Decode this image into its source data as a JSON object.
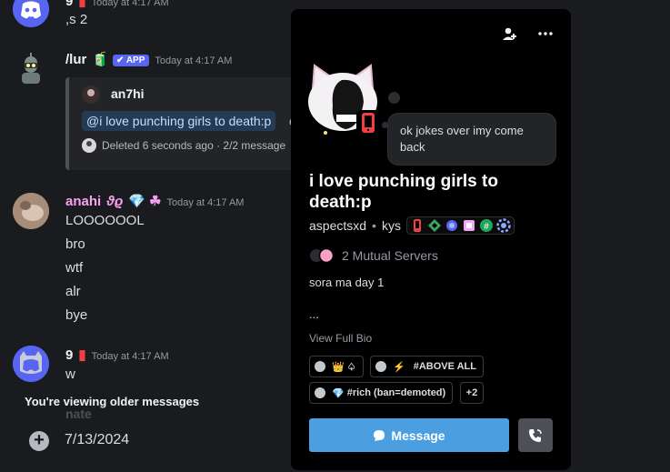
{
  "chat": {
    "top_message": {
      "username": "9",
      "timestamp": "Today at 4:17 AM",
      "text": ",s 2"
    },
    "bot_message": {
      "username": "/lur",
      "badge": "APP",
      "timestamp": "Today at 4:17 AM",
      "embed": {
        "author": "an7hi",
        "command_pill": "@i love punching girls to death:p",
        "command_suffix": "c",
        "footer": "Deleted 6 seconds ago · 2/2 message"
      }
    },
    "anahi_message": {
      "username": "anahi",
      "timestamp": "Today at 4:17 AM",
      "lines": [
        "LOOOOOOL",
        "bro",
        "wtf",
        "alr",
        "bye"
      ]
    },
    "nine_message": {
      "username": "9",
      "timestamp": "Today at 4:17 AM",
      "text": "w"
    },
    "older_banner": "You're viewing older messages",
    "faded_username": "nate",
    "composer_date": "7/13/2024"
  },
  "profile": {
    "custom_status": "ok jokes over imy come back",
    "display_name": "i love punching girls to death:p",
    "username": "aspectsxd",
    "pronouns": "kys",
    "mutual_servers": "2 Mutual Servers",
    "bio_line1": "sora ma day 1",
    "bio_line2": "...",
    "view_full_bio": "View Full Bio",
    "roles": [
      {
        "label": ""
      },
      {
        "label": "#ABOVE ALL"
      },
      {
        "label": "#rich (ban=demoted)"
      }
    ],
    "roles_more": "+2",
    "message_button": "Message"
  },
  "colors": {
    "accent": "#4b9fe1",
    "app_badge": "#5865f2",
    "anahi_name": "#f7a1f0",
    "phone_status": "#f23f43"
  },
  "icons": [
    "add-friend-icon",
    "more-icon",
    "mobile-status-icon",
    "message-bubble-icon",
    "call-icon",
    "plus-circle-icon"
  ]
}
